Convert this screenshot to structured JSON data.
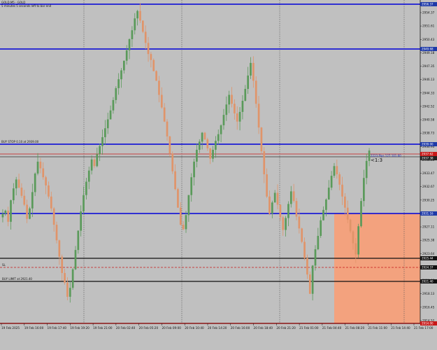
{
  "header": {
    "symbol_line": "GOLD,M5 - GOLD",
    "countdown": "5 minutes 5 seconds left to bar end"
  },
  "annotations": {
    "buy_stop_label": "BUY STOP 0.10 at 2939.00",
    "trade_label": "2223 Pips 127.101.60",
    "rr_label": "<1:3",
    "sl_label": "SL",
    "buy_limit_label": "BUY LIMIT at 2921.40"
  },
  "price_tags": {
    "top": "2956.37",
    "upper": "2949.68",
    "buy_stop": "2939.00",
    "bid": "2937.62",
    "ask": "2937.38",
    "mid": "2931.16",
    "black1": "2925.44",
    "black2": "2924.37",
    "black3": "2921.40",
    "bottom": "2914.00"
  },
  "price_axis": {
    "ticks": [
      "2954.37",
      "2951.61",
      "2950.43",
      "2949.18",
      "2947.35",
      "2946.13",
      "2944.33",
      "2942.52",
      "2940.58",
      "2938.73",
      "2936.93",
      "2935.03",
      "2933.47",
      "2932.67",
      "2930.25",
      "2928.59",
      "2927.11",
      "2925.38",
      "2923.64",
      "2921.84",
      "2920.06",
      "2918.13",
      "2916.45",
      "2914.52"
    ]
  },
  "time_axis": {
    "labels": [
      "19 Feb 2025",
      "19 Feb 16:00",
      "19 Feb 17:40",
      "19 Feb 19:20",
      "19 Feb 21:00",
      "20 Feb 02:40",
      "20 Feb 05:20",
      "20 Feb 09:00",
      "20 Feb 10:40",
      "20 Feb 14:20",
      "20 Feb 16:00",
      "20 Feb 18:40",
      "20 Feb 21:20",
      "21 Feb 01:00",
      "21 Feb 04:40",
      "21 Feb 08:20",
      "21 Feb 11:00",
      "21 Feb 14:40",
      "21 Feb 17:00"
    ]
  },
  "colors": {
    "background": "#c0c0c0",
    "bull": "#5a9a5a",
    "bear": "#e0946a",
    "blue_line": "#0000d8",
    "red_line": "#c81818",
    "black_line": "#111111",
    "zone": "#f5a07a",
    "tag_blue": "#1e3aa8",
    "tag_red": "#c81818",
    "tag_black": "#111111"
  },
  "chart_data": {
    "type": "candlestick",
    "y_range": [
      2914.0,
      2957.0
    ],
    "series": [
      {
        "values": [
          2928.6,
          2929.0,
          2927.5,
          2930.4,
          2932.0,
          2933.2,
          2932.1,
          2931.0,
          2929.8,
          2927.9,
          2929.3,
          2931.5,
          2934.0,
          2935.6,
          2934.7,
          2933.5,
          2932.4,
          2930.9,
          2929.3,
          2927.1,
          2925.0,
          2922.8,
          2920.6,
          2919.3,
          2917.4,
          2918.6,
          2921.1,
          2923.7,
          2926.3,
          2928.9,
          2931.1,
          2932.9,
          2934.4,
          2935.9,
          2935.0,
          2936.6,
          2937.7,
          2938.9,
          2940.1,
          2941.3,
          2942.5,
          2943.9,
          2945.5,
          2946.7,
          2947.9,
          2949.2,
          2950.6,
          2952.1,
          2953.3,
          2954.9,
          2955.9,
          2954.6,
          2953.1,
          2951.6,
          2950.1,
          2949.3,
          2947.8,
          2946.5,
          2944.6,
          2942.9,
          2941.0,
          2939.0,
          2936.7,
          2934.3,
          2931.9,
          2929.4,
          2927.1,
          2926.5,
          2928.4,
          2931.1,
          2933.5,
          2935.6,
          2937.2,
          2938.3,
          2939.5,
          2938.6,
          2937.4,
          2936.0,
          2937.2,
          2938.4,
          2939.3,
          2940.5,
          2941.9,
          2943.3,
          2944.6,
          2943.4,
          2942.1,
          2941.0,
          2942.3,
          2943.8,
          2945.4,
          2947.2,
          2948.9,
          2946.5,
          2943.4,
          2940.2,
          2937.0,
          2933.9,
          2930.9,
          2928.6,
          2930.1,
          2931.4,
          2929.8,
          2928.1,
          2926.4,
          2928.0,
          2929.9,
          2931.6,
          2930.3,
          2928.2,
          2926.6,
          2924.8,
          2922.6,
          2920.4,
          2917.8,
          2921.6,
          2923.8,
          2925.6,
          2927.7,
          2929.1,
          2930.5,
          2932.1,
          2933.7,
          2935.0,
          2933.9,
          2932.5,
          2930.9,
          2929.4,
          2927.8,
          2926.2,
          2924.6,
          2923.1,
          2926.9,
          2930.3,
          2933.4,
          2935.7,
          2937.1
        ]
      }
    ]
  }
}
